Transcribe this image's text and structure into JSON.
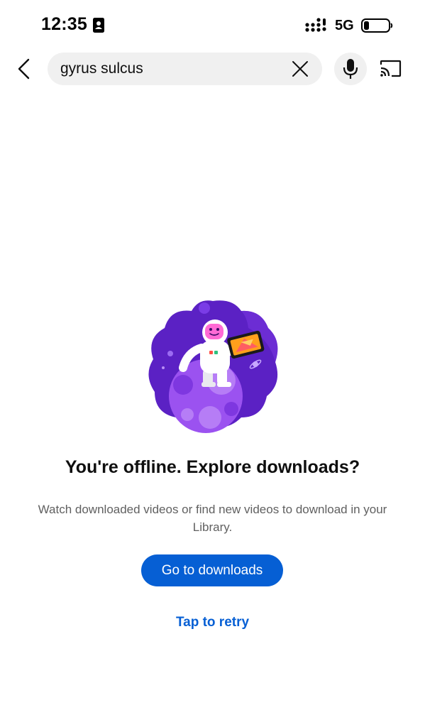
{
  "status_bar": {
    "time": "12:35",
    "network": "5G",
    "battery_level": 0.2,
    "icons": [
      "contact-card-icon",
      "signal-icon",
      "battery-icon"
    ]
  },
  "search": {
    "query": "gyrus sulcus",
    "icons": [
      "back-arrow-icon",
      "close-icon",
      "microphone-icon",
      "cast-icon"
    ]
  },
  "offline": {
    "illustration": "astronaut-on-planet-icon",
    "title": "You're offline. Explore downloads?",
    "message": "Watch downloaded videos or find new videos to download in your Library.",
    "primary_button": "Go to downloads",
    "retry_link": "Tap to retry"
  },
  "colors": {
    "accent": "#065fd4",
    "search_bg": "#f0f0f0",
    "illustration_purple": "#5b21c4",
    "planet_purple": "#9b52f0"
  }
}
